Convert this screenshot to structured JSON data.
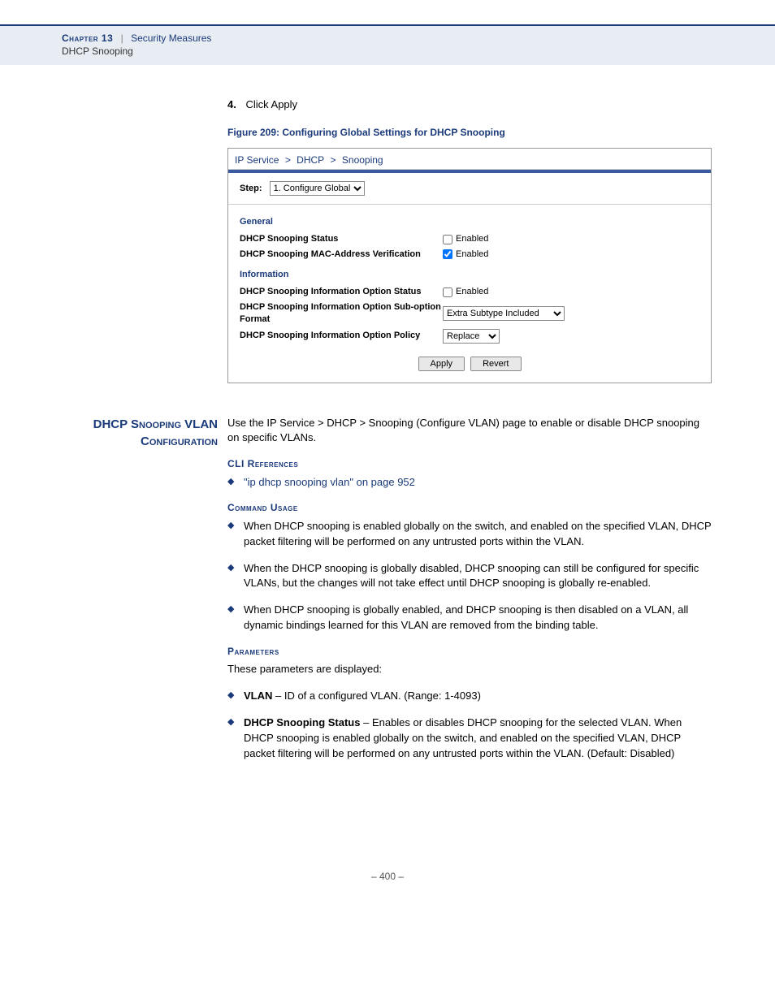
{
  "header": {
    "chapter_label": "Chapter 13",
    "section_title": "Security Measures",
    "sub_title": "DHCP Snooping"
  },
  "step4": {
    "num": "4.",
    "text": "Click Apply"
  },
  "figure": {
    "caption": "Figure 209:  Configuring Global Settings for DHCP Snooping"
  },
  "panel": {
    "crumb": [
      "IP Service",
      ">",
      "DHCP",
      ">",
      "Snooping"
    ],
    "step_label": "Step:",
    "step_value": "1. Configure Global",
    "sections": {
      "general": {
        "title": "General",
        "rows": [
          {
            "label": "DHCP Snooping Status",
            "type": "checkbox",
            "checked": false,
            "text": "Enabled"
          },
          {
            "label": "DHCP Snooping MAC-Address Verification",
            "type": "checkbox",
            "checked": true,
            "text": "Enabled"
          }
        ]
      },
      "information": {
        "title": "Information",
        "rows": [
          {
            "label": "DHCP Snooping Information Option Status",
            "type": "checkbox",
            "checked": false,
            "text": "Enabled"
          },
          {
            "label": "DHCP Snooping Information Option Sub-option Format",
            "type": "select",
            "value": "Extra Subtype Included"
          },
          {
            "label": "DHCP Snooping Information Option Policy",
            "type": "select",
            "value": "Replace"
          }
        ]
      }
    },
    "buttons": {
      "apply": "Apply",
      "revert": "Revert"
    }
  },
  "article": {
    "side_heading": "DHCP Snooping VLAN Configuration",
    "intro": "Use the IP Service > DHCP > Snooping (Configure VLAN) page to enable or disable DHCP snooping on specific VLANs.",
    "cli_hdr": "CLI References",
    "cli_link": "\"ip dhcp snooping vlan\" on page 952",
    "usage_hdr": "Command Usage",
    "usage": [
      "When DHCP snooping is enabled globally on the switch, and enabled on the specified VLAN, DHCP packet filtering will be performed on any untrusted ports within the VLAN.",
      "When the DHCP snooping is globally disabled, DHCP snooping can still be configured for specific VLANs, but the changes will not take effect until DHCP snooping is globally re-enabled.",
      "When DHCP snooping is globally enabled, and DHCP snooping is then disabled on a VLAN, all dynamic bindings learned for this VLAN are removed from the binding table."
    ],
    "params_hdr": "Parameters",
    "params_intro": "These parameters are displayed:",
    "params": [
      {
        "name": "VLAN",
        "desc": " – ID of a configured VLAN. (Range: 1-4093)"
      },
      {
        "name": "DHCP Snooping Status",
        "desc": " – Enables or disables DHCP snooping for the selected VLAN. When DHCP snooping is enabled globally on the switch, and enabled on the specified VLAN, DHCP packet filtering will be performed on any untrusted ports within the VLAN. (Default: Disabled)"
      }
    ]
  },
  "footer": {
    "page": "–  400  –"
  }
}
